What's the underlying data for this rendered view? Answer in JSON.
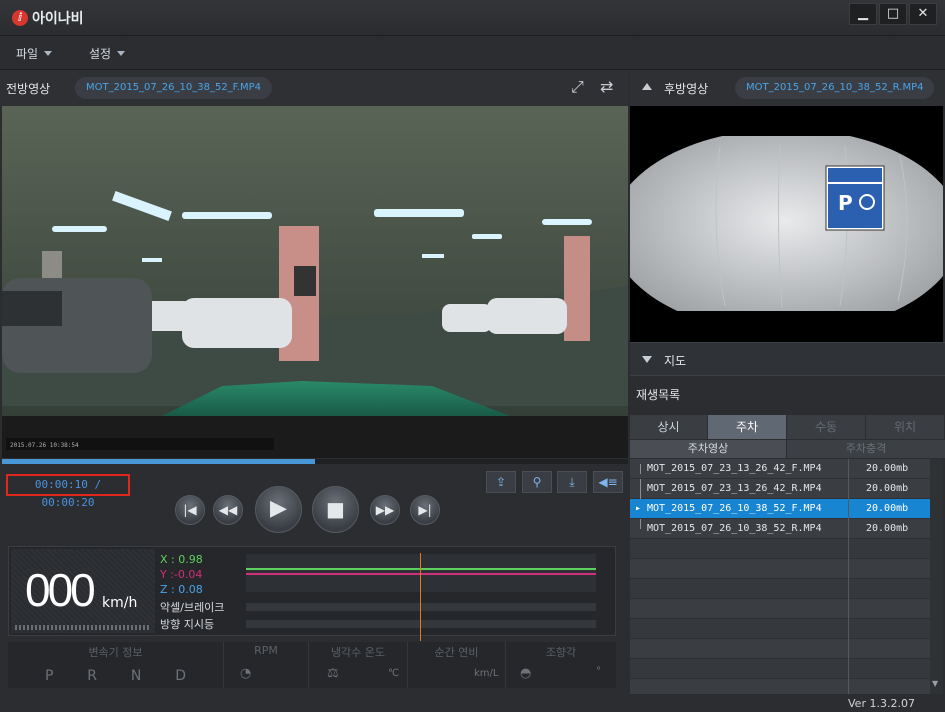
{
  "app": {
    "title": "아이나비"
  },
  "window_buttons": {
    "minimize": "▁",
    "maximize": "□",
    "close": "✕"
  },
  "menu": {
    "file": "파일",
    "settings": "설정"
  },
  "front": {
    "label": "전방영상",
    "file": "MOT_2015_07_26_10_38_52_F.MP4",
    "overlay_date": "2015.07.26 10:38:54"
  },
  "rear": {
    "label": "후방영상",
    "file": "MOT_2015_07_26_10_38_52_R.MP4"
  },
  "playback": {
    "current": "00:00:10",
    "separator": " / ",
    "total": "00:00:20",
    "progress": 0.5
  },
  "speed": {
    "value": "000",
    "unit": "km/h"
  },
  "gsensor": {
    "x": "X : 0.98",
    "y": "Y :-0.04",
    "z": "Z : 0.08",
    "accel": "악셀/브레이크",
    "turn": "방향 지시등"
  },
  "gauges": {
    "transmission": "변속기 정보",
    "gears": [
      "P",
      "R",
      "N",
      "D"
    ],
    "rpm": "RPM",
    "coolant": "냉각수 온도",
    "coolant_unit": "℃",
    "fuel": "순간 연비",
    "fuel_unit": "km/L",
    "steering": "조향각",
    "steering_unit": "°"
  },
  "map": {
    "label": "지도"
  },
  "playlist": {
    "title": "재생목록",
    "tabs": [
      "상시",
      "주차",
      "수동",
      "위치"
    ],
    "subtabs": [
      "주차영상",
      "주차충격"
    ],
    "rows": [
      {
        "name": "MOT_2015_07_23_13_26_42_F.MP4",
        "size": "20.00mb"
      },
      {
        "name": "MOT_2015_07_23_13_26_42_R.MP4",
        "size": "20.00mb"
      },
      {
        "name": "MOT_2015_07_26_10_38_52_F.MP4",
        "size": "20.00mb"
      },
      {
        "name": "MOT_2015_07_26_10_38_52_R.MP4",
        "size": "20.00mb"
      }
    ]
  },
  "version": "Ver 1.3.2.07",
  "colors": {
    "accent": "#1785d2",
    "time_border": "#e1261d",
    "x_line": "#5fd05f",
    "y_line": "#d0307a",
    "z_line": "#4aa3e8"
  }
}
